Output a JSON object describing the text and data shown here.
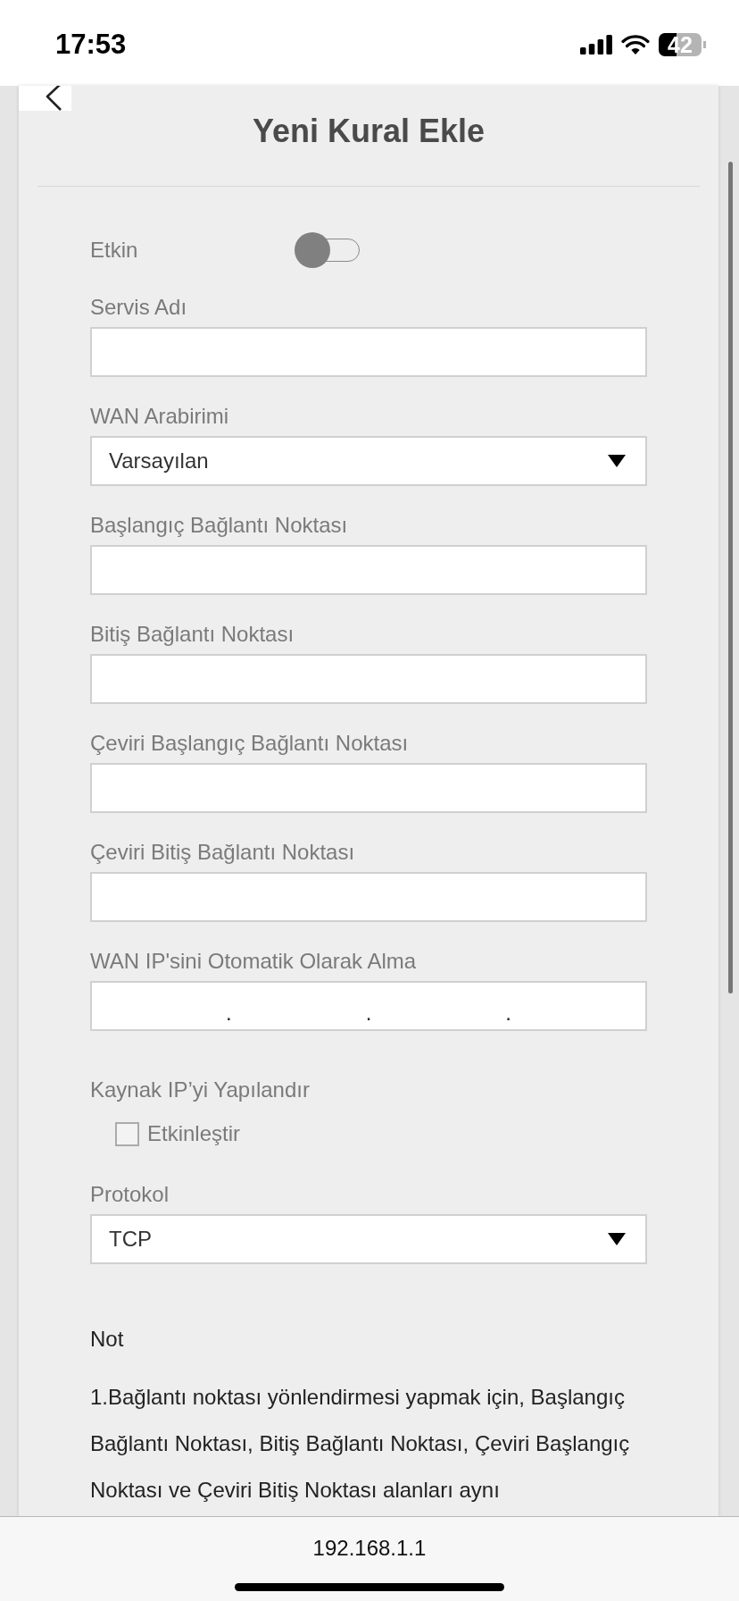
{
  "status_bar": {
    "time": "17:53",
    "battery": "42"
  },
  "header": {
    "title": "Yeni Kural Ekle"
  },
  "form": [
    {
      "kind": "toggle",
      "label": "Etkin",
      "on": false
    },
    {
      "kind": "text",
      "label": "Servis Adı"
    },
    {
      "kind": "select",
      "label": "WAN Arabirimi",
      "value": "Varsayılan"
    },
    {
      "kind": "text",
      "label": "Başlangıç Bağlantı Noktası"
    },
    {
      "kind": "text",
      "label": "Bitiş Bağlantı Noktası"
    },
    {
      "kind": "text",
      "label": "Çeviri Başlangıç Bağlantı Noktası"
    },
    {
      "kind": "text",
      "label": "Çeviri Bitiş Bağlantı Noktası"
    },
    {
      "kind": "ip",
      "label": "WAN IP'sini Otomatik Olarak Alma",
      "separators": [
        ".",
        ".",
        "."
      ]
    },
    {
      "kind": "checkbox",
      "label": "Kaynak IP’yi Yapılandır",
      "option": "Etkinleştir",
      "checked": false
    },
    {
      "kind": "select",
      "label": "Protokol",
      "value": "TCP"
    }
  ],
  "note": {
    "title": "Not",
    "text": "1.Bağlantı noktası yönlendirmesi yapmak için, Başlangıç Bağlantı Noktası, Bitiş Bağlantı Noktası, Çeviri Başlangıç Noktası ve Çeviri Bitiş Noktası alanları aynı"
  },
  "browser_bar": {
    "url": "192.168.1.1"
  }
}
